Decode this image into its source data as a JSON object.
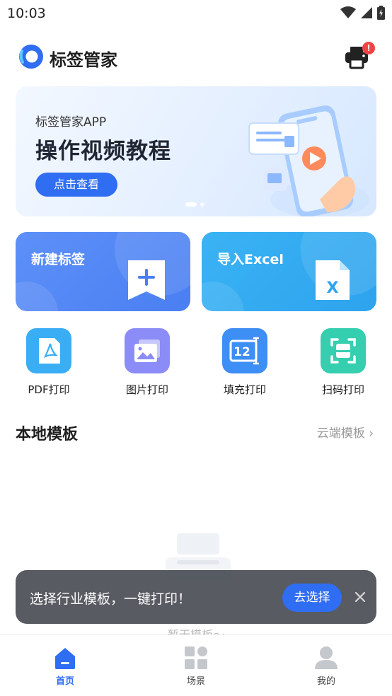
{
  "status_bar": {
    "time": "10:03"
  },
  "header": {
    "title": "标签管家",
    "printer_badge": "!"
  },
  "banner": {
    "subtitle": "标签管家APP",
    "title": "操作视频教程",
    "button_label": "点击查看"
  },
  "actions": [
    {
      "label": "新建标签"
    },
    {
      "label": "导入Excel"
    }
  ],
  "tools": [
    {
      "label": "PDF打印",
      "color": "#3aaef5",
      "icon": "pdf-icon"
    },
    {
      "label": "图片打印",
      "color": "#8b8cf7",
      "icon": "image-icon"
    },
    {
      "label": "填充打印",
      "color": "#3d8ef5",
      "icon": "fill-icon"
    },
    {
      "label": "扫码打印",
      "color": "#35cfb0",
      "icon": "scan-icon"
    }
  ],
  "section": {
    "title": "本地模板",
    "cloud_link": "云端模板 ›"
  },
  "empty": {
    "text": "暂无模板～"
  },
  "toast": {
    "message": "选择行业模板，一键打印！",
    "button_label": "去选择"
  },
  "bottom_nav": [
    {
      "label": "首页",
      "active": true
    },
    {
      "label": "场景",
      "active": false
    },
    {
      "label": "我的",
      "active": false
    }
  ],
  "colors": {
    "primary": "#2f6df3"
  }
}
